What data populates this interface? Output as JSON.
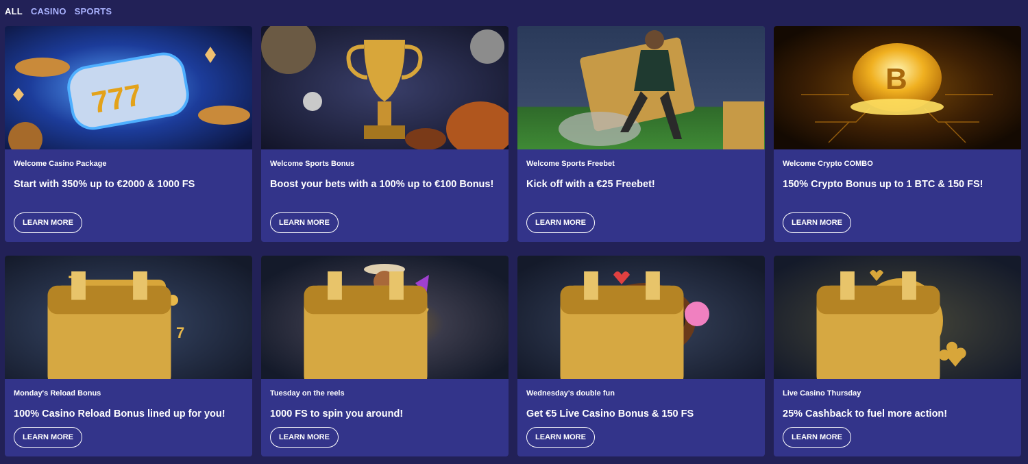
{
  "filters": {
    "tabs": [
      {
        "label": "ALL",
        "active": true
      },
      {
        "label": "CASINO",
        "active": false
      },
      {
        "label": "SPORTS",
        "active": false
      }
    ]
  },
  "cards": [
    {
      "subtitle": "Welcome Casino Package",
      "headline": "Start with 350% up to €2000 & 1000 FS",
      "button": "LEARN MORE",
      "art": "slot-reel-777-genie-lamps"
    },
    {
      "subtitle": "Welcome Sports Bonus",
      "headline": "Boost your bets with a 100% up to €100 Bonus!",
      "button": "LEARN MORE",
      "art": "gold-trophy-sports-balls"
    },
    {
      "subtitle": "Welcome Sports Freebet",
      "headline": "Kick off with a €25 Freebet!",
      "button": "LEARN MORE",
      "art": "footballer-golden-ticket"
    },
    {
      "subtitle": "Welcome Crypto COMBO",
      "headline": "150% Crypto Bonus up to 1 BTC & 150 FS!",
      "button": "LEARN MORE",
      "art": "glowing-bitcoin-coin"
    },
    {
      "subtitle": "Monday's Reload Bonus",
      "headline": "100% Casino Reload Bonus lined up for you!",
      "button": "LEARN MORE",
      "art": "golden-slot-machine"
    },
    {
      "subtitle": "Tuesday on the reels",
      "headline": "1000 FS to spin you around!",
      "button": "LEARN MORE",
      "art": "cowboy-character"
    },
    {
      "subtitle": "Wednesday's double fun",
      "headline": "Get €5 Live Casino Bonus & 150 FS",
      "button": "LEARN MORE",
      "art": "roulette-gummy-bear"
    },
    {
      "subtitle": "Live Casino Thursday",
      "headline": "25% Cashback to fuel more action!",
      "button": "LEARN MORE",
      "art": "poker-chip-spade"
    }
  ],
  "colors": {
    "page_bg": "#222157",
    "card_bg": "#33348a",
    "tab_inactive": "#aab3ff",
    "gold": "#e8b84a"
  }
}
